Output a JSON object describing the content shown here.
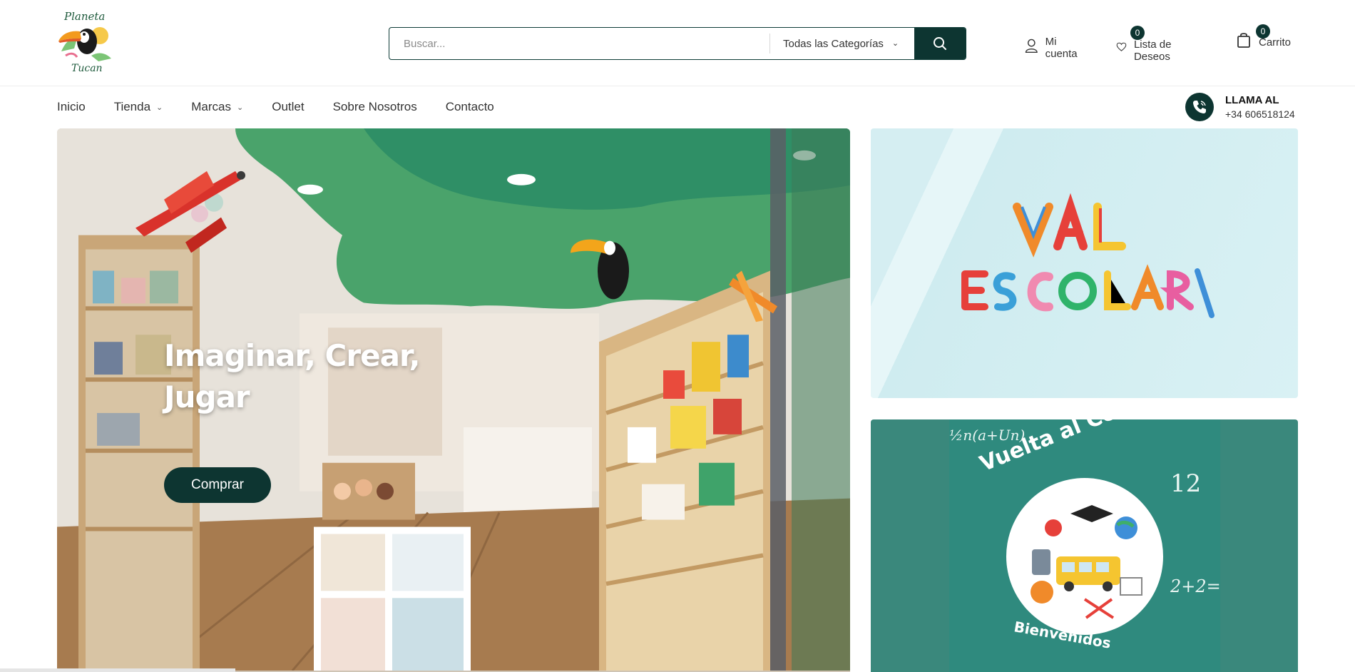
{
  "header": {
    "logo_top": "Planeta",
    "logo_bottom": "Tucan",
    "search": {
      "placeholder": "Buscar...",
      "category": "Todas las Categorías"
    },
    "account_label": "Mi cuenta",
    "wishlist_label": "Lista de Deseos",
    "wishlist_count": "0",
    "cart_label": "Carrito",
    "cart_count": "0"
  },
  "nav": {
    "items": [
      {
        "label": "Inicio"
      },
      {
        "label": "Tienda"
      },
      {
        "label": "Marcas"
      },
      {
        "label": "Outlet"
      },
      {
        "label": "Sobre Nosotros"
      },
      {
        "label": "Contacto"
      }
    ],
    "call_label": "LLAMA AL",
    "call_number": "+34 606518124"
  },
  "hero": {
    "title": "Imaginar, Crear, Jugar",
    "button": "Comprar"
  },
  "banners": {
    "top_line1": "VAL",
    "top_line2": "ESCOLAR",
    "bottom_title": "Vuelta al Cole",
    "bottom_subtitle": "Bienvenidos",
    "bottom_formula": "½n(a+Un)",
    "bottom_numbers": "12",
    "bottom_sum": "2+2="
  },
  "colors": {
    "brand_dark": "#0d3531",
    "banner_teal": "#3a887c",
    "banner_light": "#d9f1f4"
  }
}
